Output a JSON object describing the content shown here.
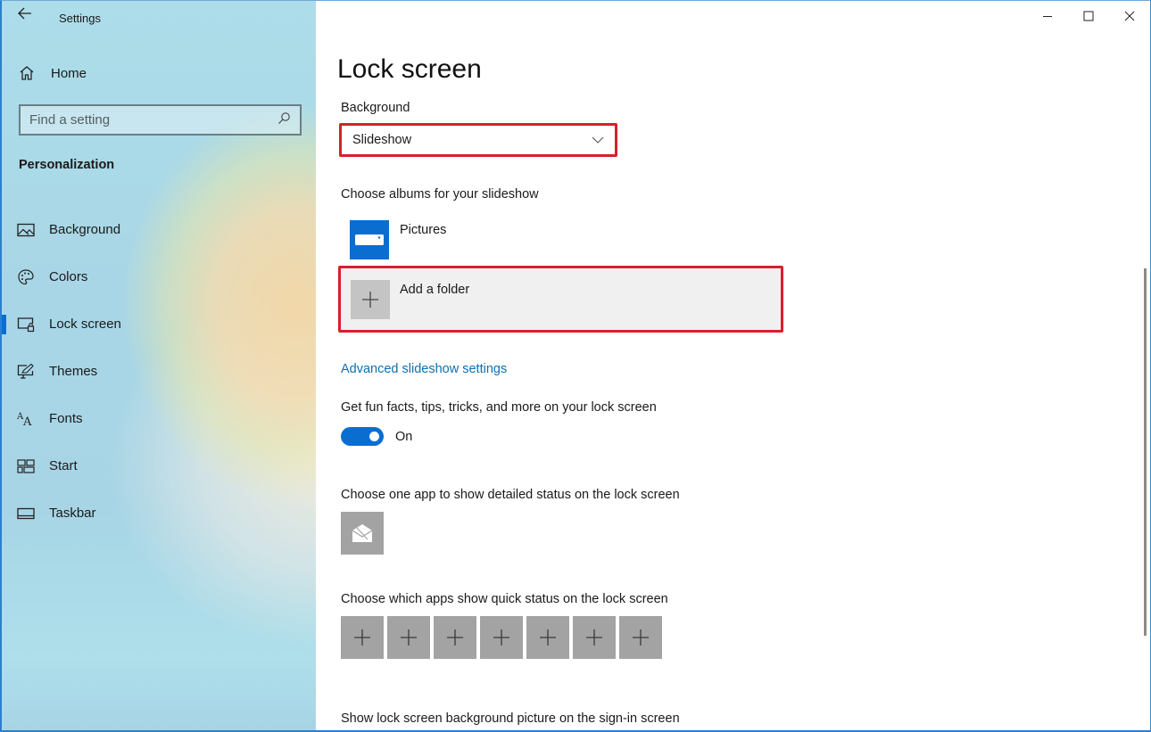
{
  "window": {
    "app_title": "Settings",
    "back_icon": "back-arrow-icon",
    "controls": {
      "minimize": "minimize-icon",
      "maximize": "maximize-icon",
      "close": "close-icon"
    }
  },
  "sidebar": {
    "home_label": "Home",
    "search": {
      "placeholder": "Find a setting",
      "value": ""
    },
    "section_title": "Personalization",
    "items": [
      {
        "label": "Background",
        "icon": "picture-icon",
        "active": false
      },
      {
        "label": "Colors",
        "icon": "palette-icon",
        "active": false
      },
      {
        "label": "Lock screen",
        "icon": "lock-screen-icon",
        "active": true
      },
      {
        "label": "Themes",
        "icon": "themes-icon",
        "active": false
      },
      {
        "label": "Fonts",
        "icon": "fonts-icon",
        "active": false
      },
      {
        "label": "Start",
        "icon": "start-icon",
        "active": false
      },
      {
        "label": "Taskbar",
        "icon": "taskbar-icon",
        "active": false
      }
    ]
  },
  "main": {
    "page_title": "Lock screen",
    "background_label": "Background",
    "background_value": "Slideshow",
    "albums_label": "Choose albums for your slideshow",
    "albums": [
      {
        "name": "Pictures",
        "icon": "pictures-folder-icon"
      }
    ],
    "add_folder_label": "Add a folder",
    "advanced_link": "Advanced slideshow settings",
    "fun_facts_label": "Get fun facts, tips, tricks, and more on your lock screen",
    "fun_facts_toggle": {
      "state": true,
      "label": "On"
    },
    "detailed_status_label": "Choose one app to show detailed status on the lock screen",
    "detailed_status_app": "mail-icon",
    "quick_status_label": "Choose which apps show quick status on the lock screen",
    "quick_status_slots": 7,
    "sign_in_label": "Show lock screen background picture on the sign-in screen"
  },
  "colors": {
    "accent": "#0a6ed1",
    "highlight": "#d7202c",
    "link": "#0d6fb0",
    "tile_gray": "#a3a3a3"
  }
}
